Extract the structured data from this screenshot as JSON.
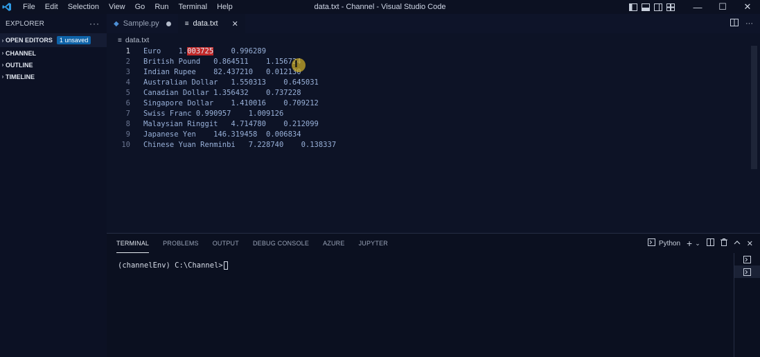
{
  "window": {
    "title": "data.txt - Channel - Visual Studio Code",
    "menu": [
      "File",
      "Edit",
      "Selection",
      "View",
      "Go",
      "Run",
      "Terminal",
      "Help"
    ],
    "minimize": "—",
    "maximize": "☐",
    "close": "✕"
  },
  "sidebar": {
    "title": "EXPLORER",
    "more": "···",
    "sections": [
      {
        "label": "OPEN EDITORS",
        "badge": "1 unsaved"
      },
      {
        "label": "CHANNEL"
      },
      {
        "label": "OUTLINE"
      },
      {
        "label": "TIMELINE"
      }
    ]
  },
  "tabs": [
    {
      "label": "Sample.py",
      "icon": "python-icon",
      "dirty": true
    },
    {
      "label": "data.txt",
      "icon": "text-file-icon",
      "active": true
    }
  ],
  "breadcrumb": {
    "file": "data.txt"
  },
  "editor": {
    "active_line": 1,
    "lines": [
      {
        "n": "1",
        "pre": "Euro    1.",
        "hl": "003725",
        "post": "    0.996289"
      },
      {
        "n": "2",
        "pre": "British Pound   0.864511    1.156724",
        "hl": "",
        "post": ""
      },
      {
        "n": "3",
        "pre": "Indian Rupee    82.437210   0.012130",
        "hl": "",
        "post": ""
      },
      {
        "n": "4",
        "pre": "Australian Dollar   1.550313    0.645031",
        "hl": "",
        "post": ""
      },
      {
        "n": "5",
        "pre": "Canadian Dollar 1.356432    0.737228",
        "hl": "",
        "post": ""
      },
      {
        "n": "6",
        "pre": "Singapore Dollar    1.410016    0.709212",
        "hl": "",
        "post": ""
      },
      {
        "n": "7",
        "pre": "Swiss Franc 0.990957    1.009126",
        "hl": "",
        "post": ""
      },
      {
        "n": "8",
        "pre": "Malaysian Ringgit   4.714780    0.212099",
        "hl": "",
        "post": ""
      },
      {
        "n": "9",
        "pre": "Japanese Yen    146.319458  0.006834",
        "hl": "",
        "post": ""
      },
      {
        "n": "10",
        "pre": "Chinese Yuan Renminbi   7.228740    0.138337",
        "hl": "",
        "post": ""
      }
    ]
  },
  "panel": {
    "tabs": [
      "TERMINAL",
      "PROBLEMS",
      "OUTPUT",
      "DEBUG CONSOLE",
      "AZURE",
      "JUPYTER"
    ],
    "active_tab": "TERMINAL",
    "shell_label": "Python",
    "prompt": "(channelEnv) C:\\Channel>"
  },
  "colors": {
    "background": "#0d1326",
    "accent": "#0e63a8",
    "highlight": "#c12a2a"
  }
}
